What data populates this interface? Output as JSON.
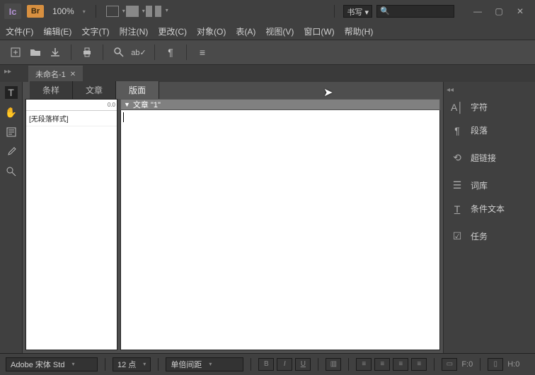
{
  "app": {
    "logo": "Ic",
    "br": "Br",
    "zoom": "100%"
  },
  "search_mode": "书写",
  "menu": [
    "文件(F)",
    "编辑(E)",
    "文字(T)",
    "附注(N)",
    "更改(C)",
    "对象(O)",
    "表(A)",
    "视图(V)",
    "窗口(W)",
    "帮助(H)"
  ],
  "doc_tab": "未命名-1",
  "center_tabs": [
    "条样",
    "文章",
    "版面"
  ],
  "style_list_item": "[无段落样式]",
  "ruler_mark": "0.0",
  "article_title": "文章 \"1\"",
  "right_panels": {
    "char": "字符",
    "para": "段落",
    "hyperlink": "超链接",
    "thesaurus": "词库",
    "cond_text": "条件文本",
    "tasks": "任务"
  },
  "status": {
    "font": "Adobe 宋体 Std",
    "size": "12 点",
    "spacing": "单倍间距",
    "frame": "F:0",
    "height": "H:0"
  }
}
